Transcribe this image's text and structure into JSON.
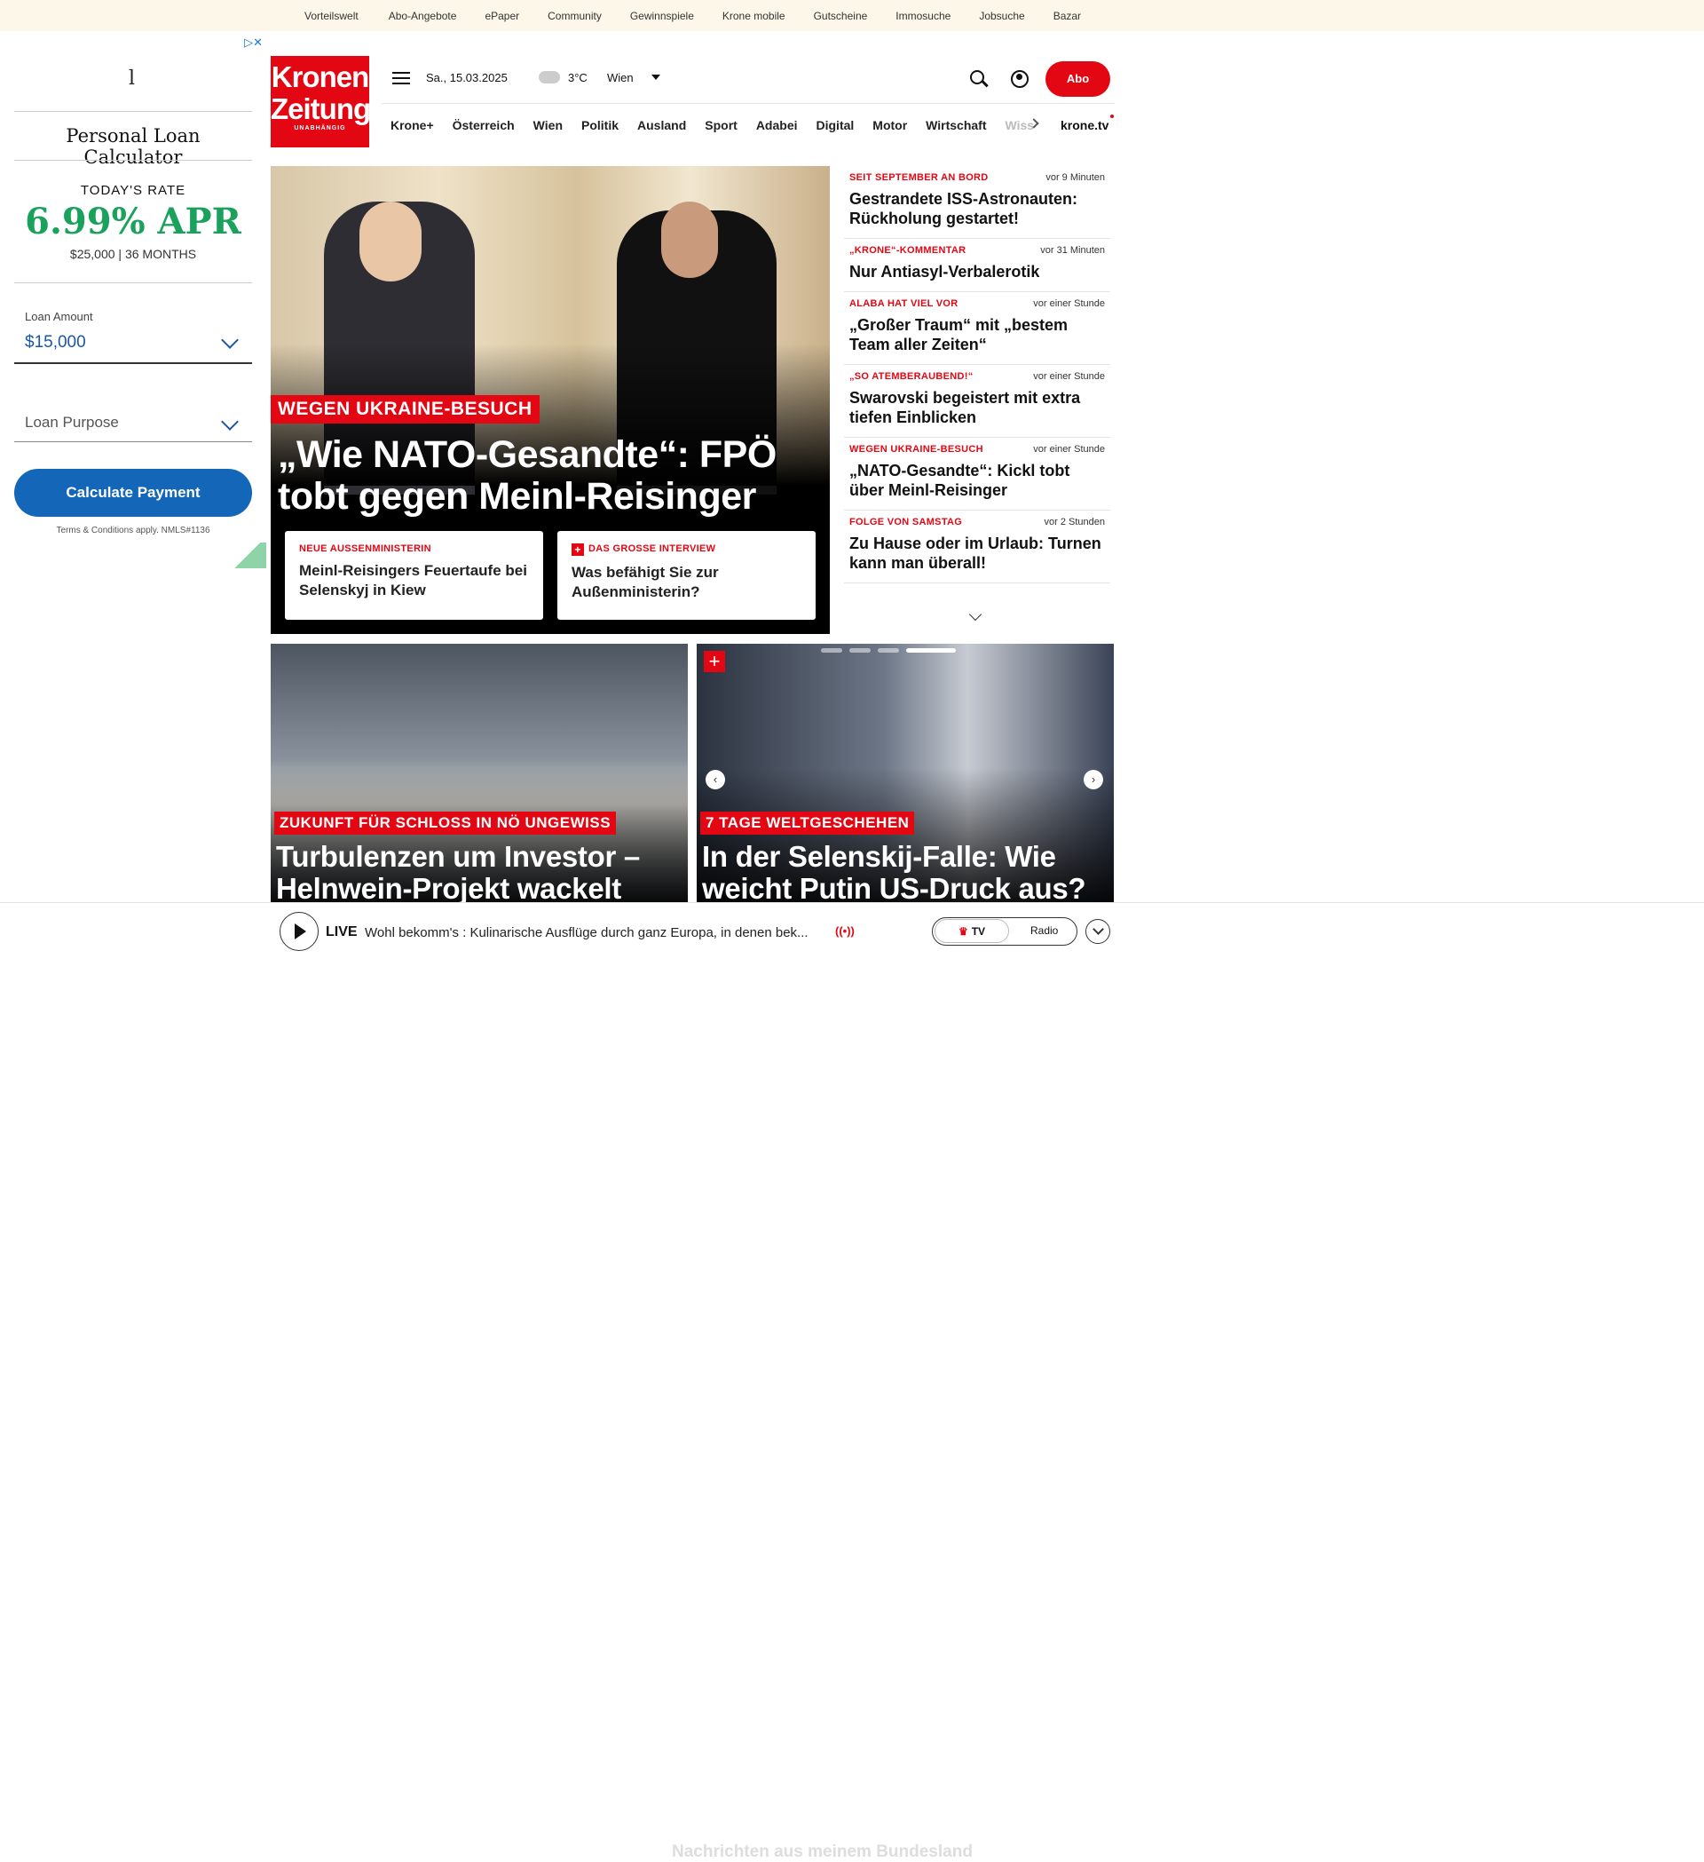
{
  "topbar": {
    "links": [
      "Vorteilswelt",
      "Abo-Angebote",
      "ePaper",
      "Community",
      "Gewinnspiele",
      "Krone mobile",
      "Gutscheine",
      "Immosuche",
      "Jobsuche",
      "Bazar"
    ]
  },
  "ad": {
    "logo": "l",
    "title": "Personal Loan Calculator",
    "rate_label": "TODAY'S RATE",
    "rate": "6.99% APR",
    "rate_terms": "$25,000 | 36 MONTHS",
    "loan_amount_label": "Loan Amount",
    "loan_amount_value": "$15,000",
    "loan_purpose_placeholder": "Loan Purpose",
    "button": "Calculate Payment",
    "fine_print": "Terms & Conditions apply. NMLS#1136"
  },
  "header": {
    "logo_line1": "Kronen",
    "logo_line2": "Zeitung",
    "logo_tag": "UNABHÄNGIG",
    "date": "Sa., 15.03.2025",
    "temperature": "3°C",
    "city": "Wien",
    "abo": "Abo"
  },
  "nav": {
    "items": [
      "Krone+",
      "Österreich",
      "Wien",
      "Politik",
      "Ausland",
      "Sport",
      "Adabei",
      "Digital",
      "Motor",
      "Wirtschaft"
    ],
    "faded": "Wiss",
    "tv": "krone.tv"
  },
  "hero": {
    "kicker": "WEGEN UKRAINE-BESUCH",
    "title": "„Wie NATO-Gesandte“: FPÖ tobt gegen Meinl-Reisinger",
    "sub": [
      {
        "kicker": "NEUE AUSSENMINISTERIN",
        "title": "Meinl-Reisingers Feuertaufe bei Selenskyj in Kiew"
      },
      {
        "kicker": "DAS GROSSE INTERVIEW",
        "title": "Was befähigt Sie zur Außenministerin?"
      }
    ]
  },
  "news": [
    {
      "kicker": "SEIT SEPTEMBER AN BORD",
      "time": "vor 9 Minuten",
      "title": "Gestrandete ISS-Astronauten: Rückholung gestartet!"
    },
    {
      "kicker": "„KRONE“-KOMMENTAR",
      "time": "vor 31 Minuten",
      "title": "Nur Antiasyl-Verbalerotik"
    },
    {
      "kicker": "ALABA HAT VIEL VOR",
      "time": "vor einer Stunde",
      "title": "„Großer Traum“ mit „bestem Team aller Zeiten“"
    },
    {
      "kicker": "„SO ATEMBERAUBEND!“",
      "time": "vor einer Stunde",
      "title": "Swarovski begeistert mit extra tiefen Einblicken"
    },
    {
      "kicker": "WEGEN UKRAINE-BESUCH",
      "time": "vor einer Stunde",
      "title": "„NATO-Gesandte“: Kickl tobt über Meinl-Reisinger"
    },
    {
      "kicker": "FOLGE VON SAMSTAG",
      "time": "vor 2 Stunden",
      "title": "Zu Hause oder im Urlaub: Turnen kann man überall!"
    }
  ],
  "cards": [
    {
      "kicker": "ZUKUNFT FÜR SCHLOSS IN NÖ UNGEWISS",
      "title": "Turbulenzen um Investor – Helnwein-Projekt wackelt"
    },
    {
      "kicker": "7 TAGE WELTGESCHEHEN",
      "title": "In der Selenskij-Falle: Wie weicht Putin US-Druck aus?"
    }
  ],
  "live": {
    "label": "LIVE",
    "text": "Wohl bekomm's : Kulinarische Ausflüge durch ganz Europa, in denen bek...",
    "tv": "TV",
    "radio": "Radio",
    "bleed": "Nachrichten aus meinem Bundesland"
  }
}
